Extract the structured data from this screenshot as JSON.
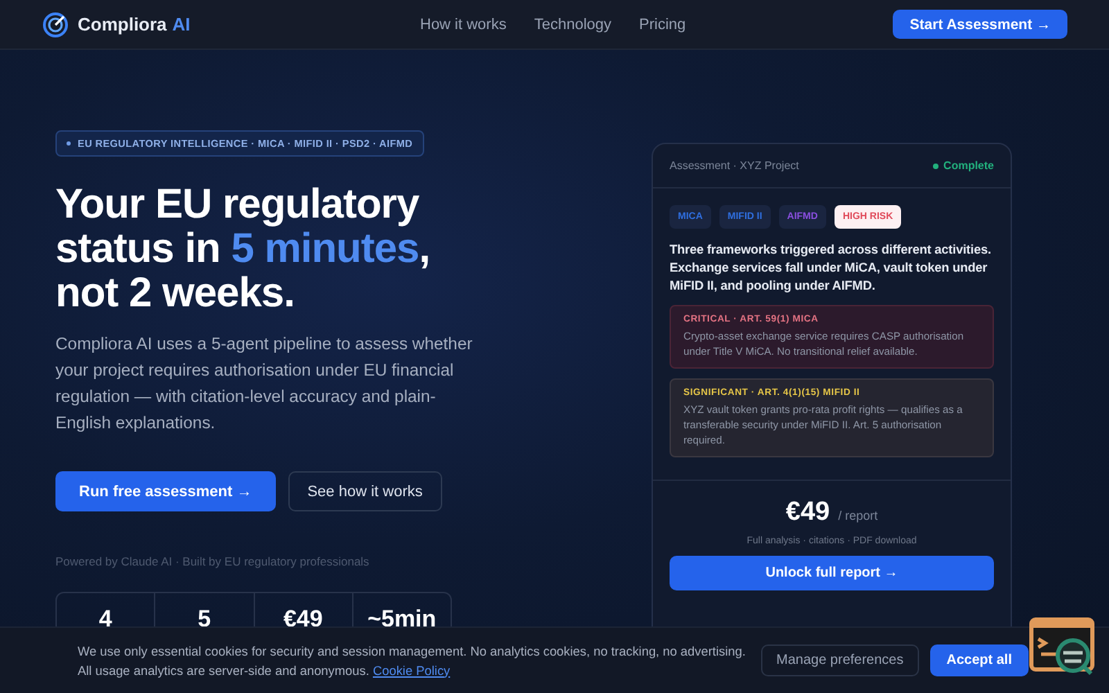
{
  "nav": {
    "brand": "Compliora",
    "brand_suffix": "AI",
    "links": [
      "How it works",
      "Technology",
      "Pricing"
    ],
    "cta": "Start Assessment →"
  },
  "hero": {
    "badge": "EU REGULATORY INTELLIGENCE · MICA · MIFID II · PSD2 · AIFMD",
    "headline": {
      "before": "Your EU regulatory status in ",
      "highlight": "5 minutes",
      "after": ", not 2 weeks."
    },
    "description": "Compliora AI uses a 5-agent pipeline to assess whether your project requires authorisation under EU financial regulation — with citation-level accuracy and plain-English explanations.",
    "primary_button": "Run free assessment →",
    "secondary_button": "See how it works",
    "powered_by": "Powered by Claude AI · Built by EU regulatory professionals",
    "stats": [
      "4",
      "5",
      "€49",
      "~5min"
    ]
  },
  "card": {
    "title": "Assessment · XYZ Project",
    "status": "Complete",
    "tags": [
      {
        "label": "MICA",
        "color": "#2f6fe0"
      },
      {
        "label": "MIFID II",
        "color": "#2f6fe0"
      },
      {
        "label": "AIFMD",
        "color": "#8a4fe0"
      },
      {
        "label": "HIGH RISK",
        "color": "#e04a5a"
      }
    ],
    "summary": "Three frameworks triggered across different activities. Exchange services fall under MiCA, vault token under MiFID II, and pooling under AIFMD.",
    "findings": [
      {
        "kind": "critical",
        "heading": "CRITICAL · ART. 59(1) MICA",
        "text": "Crypto-asset exchange service requires CASP authorisation under Title V MiCA. No transitional relief available."
      },
      {
        "kind": "significant",
        "heading": "SIGNIFICANT · ART. 4(1)(15) MIFID II",
        "text": "XYZ vault token grants pro-rata profit rights — qualifies as a transferable security under MiFID II. Art. 5 authorisation required."
      }
    ],
    "price": "€49",
    "price_unit": "/ report",
    "price_note": "Full analysis · citations · PDF download",
    "button": "Unlock full report →"
  },
  "cookie_banner": {
    "text": "We use only essential cookies for security and session management. No analytics cookies, no tracking, no advertising. All usage analytics are server-side and anonymous.",
    "link": "Cookie Policy",
    "buttons": [
      {
        "label": "Manage preferences",
        "kind": "secondary"
      },
      {
        "label": "Accept all",
        "kind": "primary"
      }
    ]
  }
}
